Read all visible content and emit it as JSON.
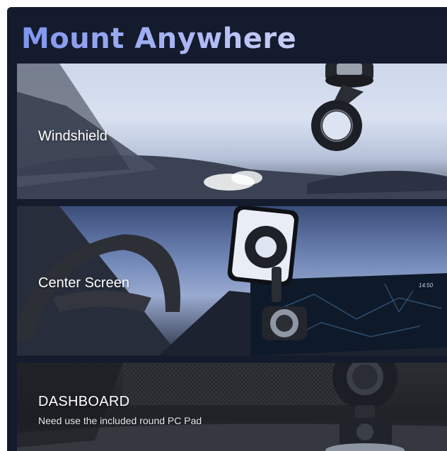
{
  "heading": "Mount Anywhere",
  "panels": [
    {
      "label": "Windshield"
    },
    {
      "label": "Center Screen",
      "screen_time": "14:50"
    },
    {
      "label": "DASHBOARD",
      "note": "Need use the included round PC Pad"
    }
  ],
  "colors": {
    "background": "#141b2d",
    "heading_gradient": [
      "#7f95ee",
      "#c9cff8"
    ],
    "label": "#ffffff"
  },
  "icons": [
    "windshield-mount-image",
    "center-screen-mount-image",
    "dashboard-mount-image"
  ]
}
